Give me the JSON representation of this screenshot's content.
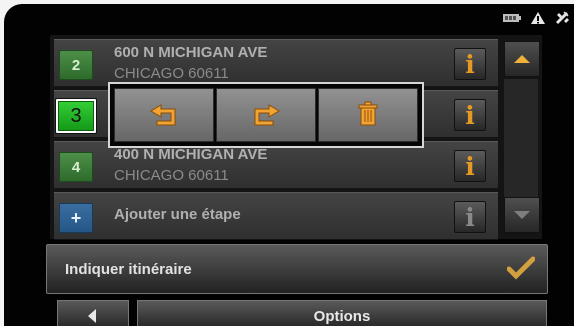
{
  "waypoints": [
    {
      "number": "2",
      "street": "600 N MICHIGAN AVE",
      "city": "CHICAGO 60611"
    },
    {
      "number": "3",
      "street": "",
      "city": ""
    },
    {
      "number": "4",
      "street": "400 N MICHIGAN AVE",
      "city": "CHICAGO 60611"
    }
  ],
  "add_stop": {
    "icon": "+",
    "label": "Ajouter une étape"
  },
  "info_label": "i",
  "popup": {
    "move_up_icon": "move-up-icon",
    "move_down_icon": "move-down-icon",
    "delete_icon": "trash-icon"
  },
  "route": {
    "label": "Indiquer itinéraire"
  },
  "options": {
    "label": "Options"
  },
  "colors": {
    "active": "#22c92a",
    "info": "#e49a23",
    "check": "#d2a13e"
  }
}
